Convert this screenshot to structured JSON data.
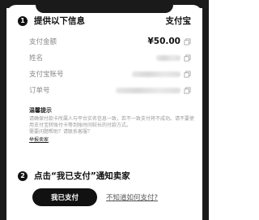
{
  "step1": {
    "number": "1",
    "title": "提供以下信息",
    "brand": "支付宝"
  },
  "fields": [
    {
      "label": "支付金额",
      "value": "¥50.00"
    },
    {
      "label": "姓名",
      "value": ""
    },
    {
      "label": "支付宝账号",
      "value": ""
    },
    {
      "label": "订单号",
      "value": ""
    }
  ],
  "tips": {
    "title": "温馨提示",
    "body": "请确保付款卡所属人与平台实名信息一致，若不一致支付将不成功。请不要使用支付宝转账付卡等到账时间较长的付款方式。",
    "body2": "需要问题帮助？请联系客服？",
    "link": "举报卖家"
  },
  "step2": {
    "number": "2",
    "title": "点击“我已支付”通知卖家"
  },
  "actions": {
    "paid_button": "我已支付",
    "help_link": "不知道如何支付?"
  }
}
